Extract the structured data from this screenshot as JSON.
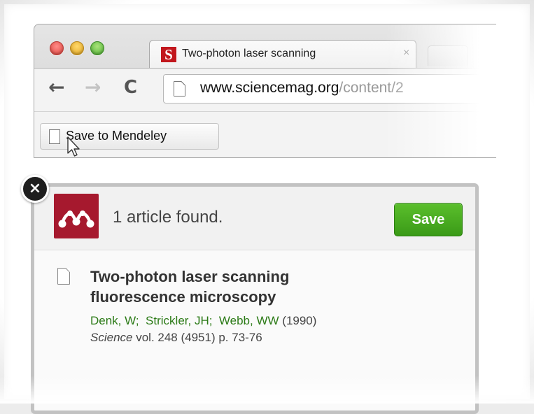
{
  "browser": {
    "tab": {
      "favicon_letter": "S",
      "title": "Two-photon laser scanning",
      "close": "×"
    },
    "nav": {
      "back": "←",
      "forward": "→",
      "reload": "C"
    },
    "url": {
      "domain": "www.sciencemag.org",
      "path": "/content/2"
    },
    "bookmark": {
      "label": "Save to Mendeley"
    }
  },
  "panel": {
    "close": "×",
    "found_text": "1 article found.",
    "save_label": "Save",
    "article": {
      "title": "Two-photon laser scanning fluorescence microscopy",
      "authors": [
        "Denk, W;",
        "Strickler, JH;",
        "Webb, WW"
      ],
      "year": "(1990)",
      "journal": "Science",
      "details": " vol. 248 (4951) p. 73-76"
    }
  },
  "colors": {
    "mendeley_red": "#a6192e",
    "save_green": "#3a9a17",
    "author_green": "#2b7a16",
    "science_red": "#c2171d"
  }
}
